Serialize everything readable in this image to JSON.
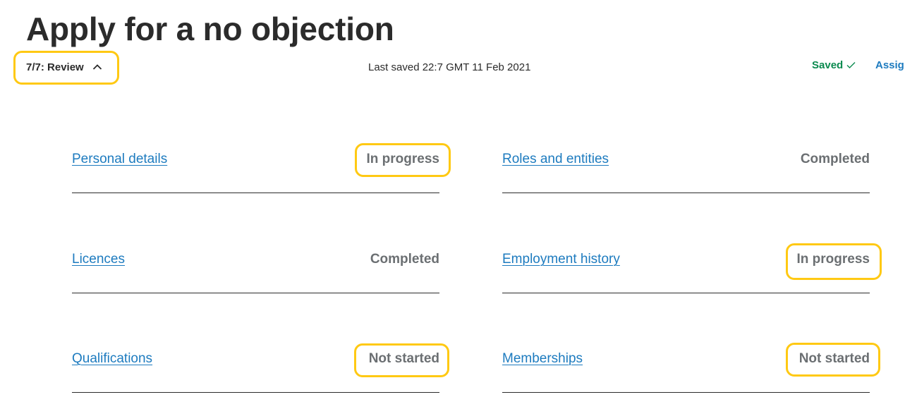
{
  "header": {
    "title": "Apply for a no objection",
    "step": {
      "label": "7/7: Review",
      "icon": "chevron-up-icon"
    },
    "last_saved": "Last saved 22:7 GMT 11 Feb 2021",
    "saved": {
      "label": "Saved",
      "icon": "check-icon"
    },
    "assign_label": "Assig"
  },
  "colors": {
    "link": "#1d7bbf",
    "status_text": "#6b6f72",
    "saved_green": "#0b8a4f",
    "highlight": "#ffc913",
    "text": "#2b2b2b"
  },
  "tasks": [
    {
      "label": "Personal details",
      "status": "In progress",
      "highlighted": true
    },
    {
      "label": "Roles and entities",
      "status": "Completed",
      "highlighted": false
    },
    {
      "label": "Licences",
      "status": "Completed",
      "highlighted": false
    },
    {
      "label": "Employment history",
      "status": "In progress",
      "highlighted": true
    },
    {
      "label": "Qualifications",
      "status": "Not started",
      "highlighted": true
    },
    {
      "label": "Memberships",
      "status": "Not started",
      "highlighted": true
    }
  ]
}
